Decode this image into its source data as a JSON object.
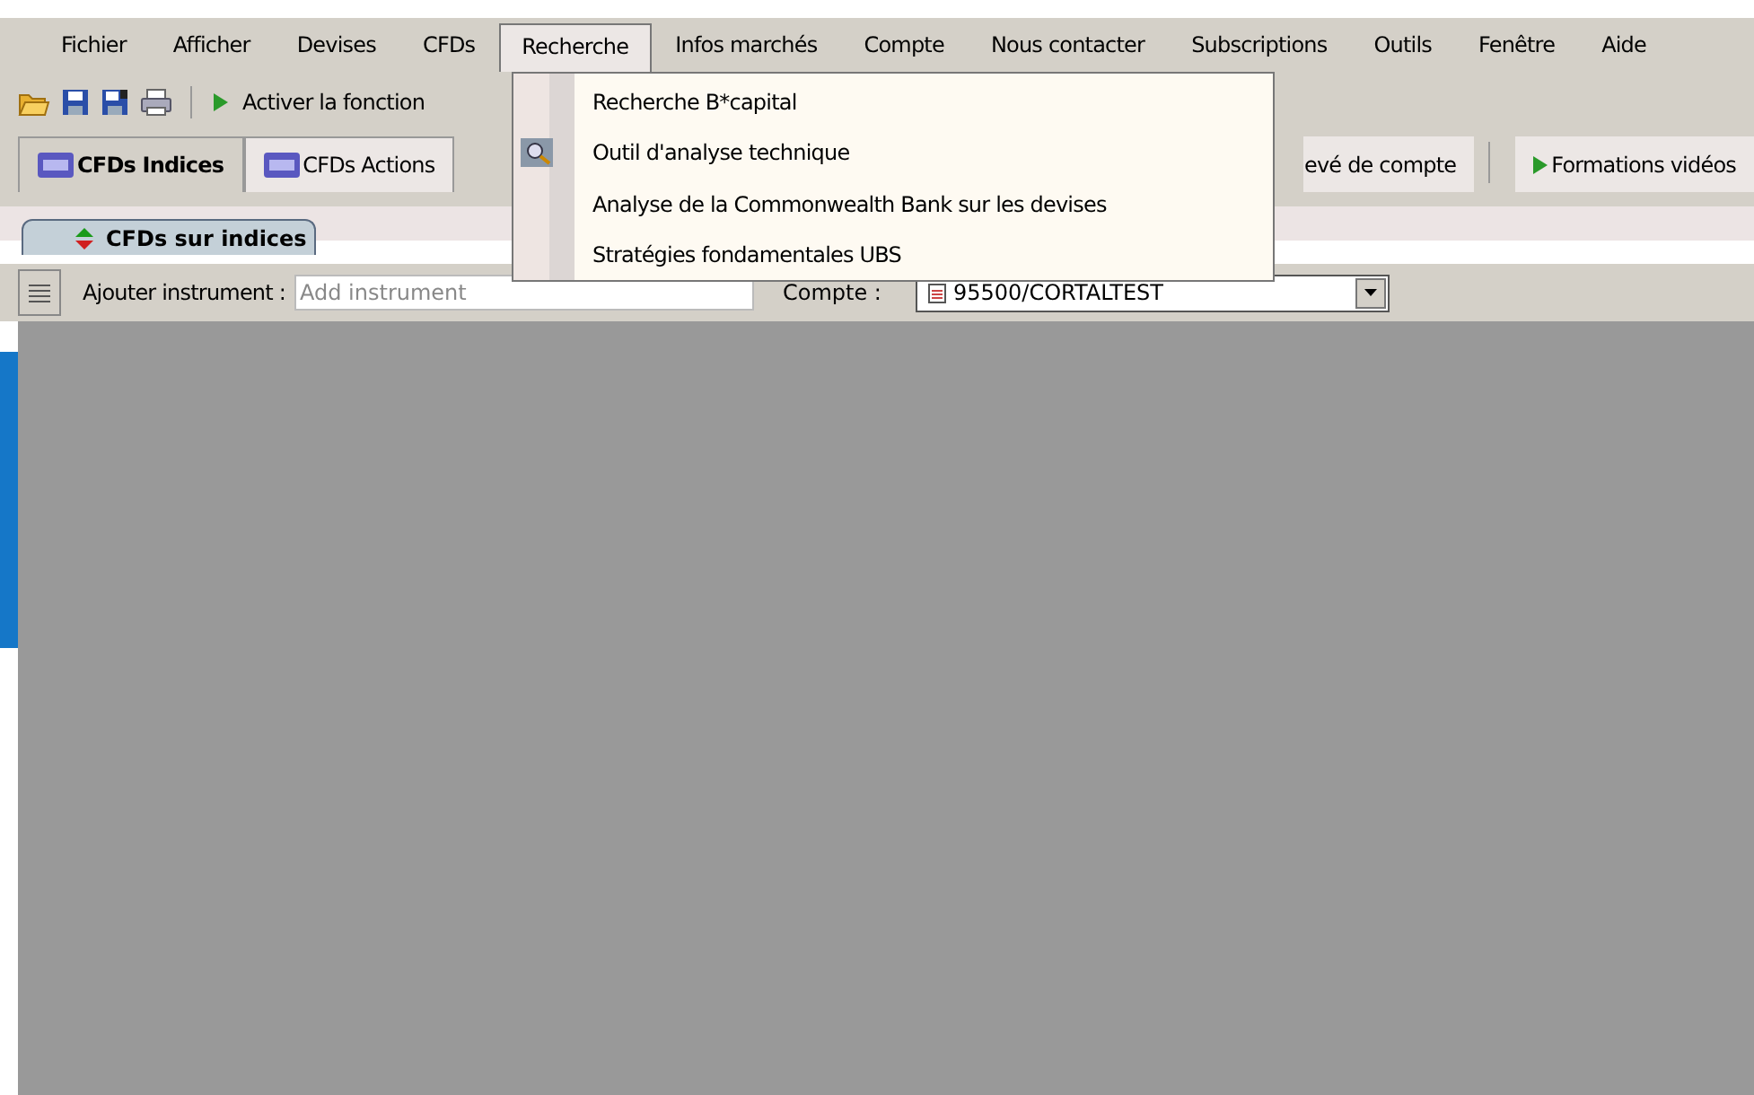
{
  "menu_bar": [
    {
      "label": "Fichier",
      "selected": false
    },
    {
      "label": "Afficher",
      "selected": false
    },
    {
      "label": "Devises",
      "selected": false
    },
    {
      "label": "CFDs",
      "selected": false
    },
    {
      "label": "Recherche",
      "selected": true
    },
    {
      "label": "Infos marchés",
      "selected": false
    },
    {
      "label": "Compte",
      "selected": false
    },
    {
      "label": "Nous contacter",
      "selected": false
    },
    {
      "label": "Subscriptions",
      "selected": false
    },
    {
      "label": "Outils",
      "selected": false
    },
    {
      "label": "Fenêtre",
      "selected": false
    },
    {
      "label": "Aide",
      "selected": false
    }
  ],
  "toolbar": {
    "action": "Activer la fonction"
  },
  "tabs": [
    {
      "label": "CFDs Indices",
      "selected": true
    },
    {
      "label": "CFDs Actions",
      "selected": false
    },
    {
      "label": "evé de compte",
      "selected": false
    },
    {
      "label": "Formations vidéos",
      "selected": false
    }
  ],
  "sub_tab": {
    "label": "CFDs sur indices"
  },
  "instrument_row": {
    "label": "Ajouter instrument :",
    "placeholder": "Add instrument",
    "account_label": "Compte :",
    "account_value": "95500/CORTALTEST"
  },
  "dropdown": [
    {
      "label": "Recherche B*capital",
      "kind": "plain"
    },
    {
      "label": "Outil d'analyse technique",
      "kind": "icon"
    },
    {
      "label": "Analyse de la Commonwealth Bank sur les devises",
      "kind": "plain"
    },
    {
      "label": "Stratégies fondamentales UBS",
      "kind": "plain"
    }
  ]
}
